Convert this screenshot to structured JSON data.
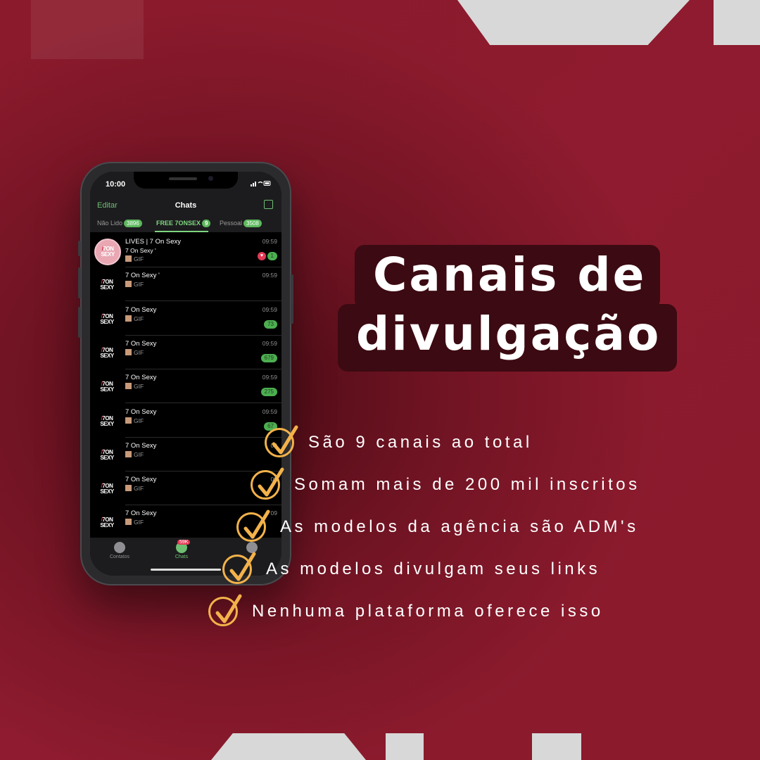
{
  "phone": {
    "status_time": "10:00",
    "nav": {
      "edit": "Editar",
      "title": "Chats"
    },
    "folders": [
      {
        "label": "Não Lido",
        "count": "3896"
      },
      {
        "label": "FREE 7ONSEX",
        "count": "9"
      },
      {
        "label": "Pessoal",
        "count": "3508"
      }
    ],
    "chats": [
      {
        "name": "LIVES | 7 On Sexy",
        "sub": "7 On Sexy '",
        "preview": "GIF",
        "time": "09:59",
        "badge": "1",
        "live": true
      },
      {
        "name": "7 On Sexy '",
        "sub": "",
        "preview": "GIF",
        "time": "09:59",
        "badge": ""
      },
      {
        "name": "7 On Sexy",
        "sub": "",
        "preview": "GIF",
        "time": "09:59",
        "badge": "73"
      },
      {
        "name": "7 On Sexy",
        "sub": "",
        "preview": "GIF",
        "time": "09:59",
        "badge": "679"
      },
      {
        "name": "7 On Sexy",
        "sub": "",
        "preview": "GIF",
        "time": "09:59",
        "badge": "275"
      },
      {
        "name": "7 On Sexy",
        "sub": "",
        "preview": "GIF",
        "time": "09:59",
        "badge": "67"
      },
      {
        "name": "7 On Sexy",
        "sub": "",
        "preview": "GIF",
        "time": "09",
        "badge": ""
      },
      {
        "name": "7 On Sexy",
        "sub": "",
        "preview": "GIF",
        "time": "09",
        "badge": ""
      },
      {
        "name": "7 On Sexy",
        "sub": "",
        "preview": "GIF",
        "time": "09",
        "badge": ""
      }
    ],
    "avatar_logo": {
      "line1": "7ON",
      "line2": "SEXY"
    },
    "tabbar": {
      "contacts": "Contatos",
      "chats": "Chats",
      "chats_badge": "59K"
    }
  },
  "headline": {
    "line1": "Canais de",
    "line2": "divulgação"
  },
  "bullets": [
    "São 9 canais ao total",
    "Somam mais de 200 mil inscritos",
    "As modelos da agência são ADM's",
    "As modelos divulgam seus links",
    "Nenhuma plataforma oferece isso"
  ],
  "colors": {
    "accent_check": "#f3b24a",
    "background": "#8e1b2f",
    "headline_box": "#3c0a12",
    "chat_green": "#4caf50"
  }
}
